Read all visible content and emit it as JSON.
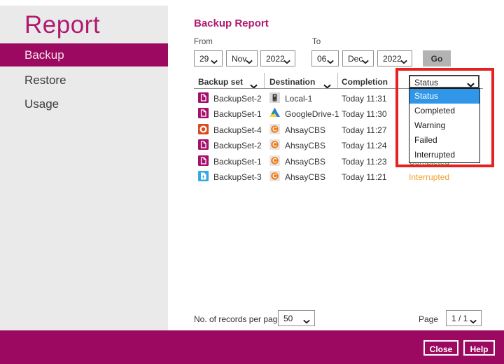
{
  "colors": {
    "brand_magenta": "#9B0A60",
    "title_magenta": "#AF1A70",
    "highlight_blue": "#3296E8",
    "annotation_red": "#E72121",
    "status_colors": {
      "Completed": "#3BAA3B",
      "Interrupted": "#F0A233"
    }
  },
  "sidebar": {
    "title": "Report",
    "items": [
      {
        "label": "Backup",
        "selected": true
      },
      {
        "label": "Restore",
        "selected": false
      },
      {
        "label": "Usage",
        "selected": false
      }
    ]
  },
  "report": {
    "title": "Backup Report",
    "filter": {
      "from_label": "From",
      "to_label": "To",
      "from_day": "29",
      "from_month": "Nov",
      "from_year": "2022",
      "to_day": "06",
      "to_month": "Dec",
      "to_year": "2022",
      "go_label": "Go"
    },
    "table": {
      "headers": {
        "backup_set": "Backup set",
        "destination": "Destination",
        "completion": "Completion",
        "status": "Status"
      },
      "rows": [
        {
          "backup_set": "BackupSet-2",
          "backup_set_icon": "file-document-icon",
          "destination": "Local-1",
          "destination_icon": "local-drive-icon",
          "completion": "Today 11:31",
          "status": ""
        },
        {
          "backup_set": "BackupSet-1",
          "backup_set_icon": "file-document-icon",
          "destination": "GoogleDrive-1",
          "destination_icon": "google-drive-icon",
          "completion": "Today 11:30",
          "status": ""
        },
        {
          "backup_set": "BackupSet-4",
          "backup_set_icon": "office365-icon",
          "destination": "AhsayCBS",
          "destination_icon": "ahsaycbs-icon",
          "completion": "Today 11:27",
          "status": ""
        },
        {
          "backup_set": "BackupSet-2",
          "backup_set_icon": "file-document-icon",
          "destination": "AhsayCBS",
          "destination_icon": "ahsaycbs-icon",
          "completion": "Today 11:24",
          "status": ""
        },
        {
          "backup_set": "BackupSet-1",
          "backup_set_icon": "file-document-icon",
          "destination": "AhsayCBS",
          "destination_icon": "ahsaycbs-icon",
          "completion": "Today 11:23",
          "status": "Completed"
        },
        {
          "backup_set": "BackupSet-3",
          "backup_set_icon": "cloud-file-icon",
          "destination": "AhsayCBS",
          "destination_icon": "ahsaycbs-icon",
          "completion": "Today 11:21",
          "status": "Interrupted"
        }
      ]
    },
    "status_dropdown": {
      "value": "Status",
      "options": [
        "Status",
        "Completed",
        "Warning",
        "Failed",
        "Interrupted"
      ],
      "highlighted_option": "Status"
    },
    "pagination": {
      "records_label": "No. of records per page",
      "records_per_page": "50",
      "page_label": "Page",
      "page_value": "1 / 1"
    }
  },
  "footer": {
    "close_label": "Close",
    "help_label": "Help"
  }
}
